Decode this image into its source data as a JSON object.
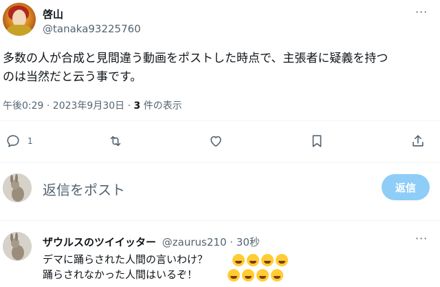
{
  "tweet": {
    "author_name": "啓山",
    "author_handle": "@tanaka93225760",
    "more": "···",
    "text_line1": "多数の人が合成と見間違う動画をポストした時点で、主張者に疑義を持つ",
    "text_line2": "のは当然だと云う事です。",
    "time": "午後0:29 · 2023年9月30日 · ",
    "views_count": "3",
    "views_label": " 件の表示"
  },
  "actions": {
    "reply_count": "1",
    "icons": [
      "reply-icon",
      "retweet-icon",
      "like-icon",
      "bookmark-icon",
      "share-icon"
    ]
  },
  "composer": {
    "placeholder": "返信をポスト",
    "button": "返信"
  },
  "reply": {
    "author_name": "ザウルスのツイイッター",
    "author_handle": "@zaurus210",
    "time": " · 30秒",
    "more": "···",
    "line1": "デマに踊らされた人間の言いわけ？",
    "line2": "踊らされなかった人間はいるぞ！",
    "line1_emoji": [
      "rolling-on-floor-laughing",
      "rolling-on-floor-laughing",
      "rolling-on-floor-laughing",
      "rolling-on-floor-laughing"
    ],
    "line2_emoji": [
      "grinning-squinting-face",
      "grinning-squinting-face",
      "grinning-squinting-face",
      "grinning-squinting-face"
    ]
  },
  "colors": {
    "accent": "#1d9bf0",
    "button_disabled": "#8ecdf8",
    "muted": "#536471"
  }
}
